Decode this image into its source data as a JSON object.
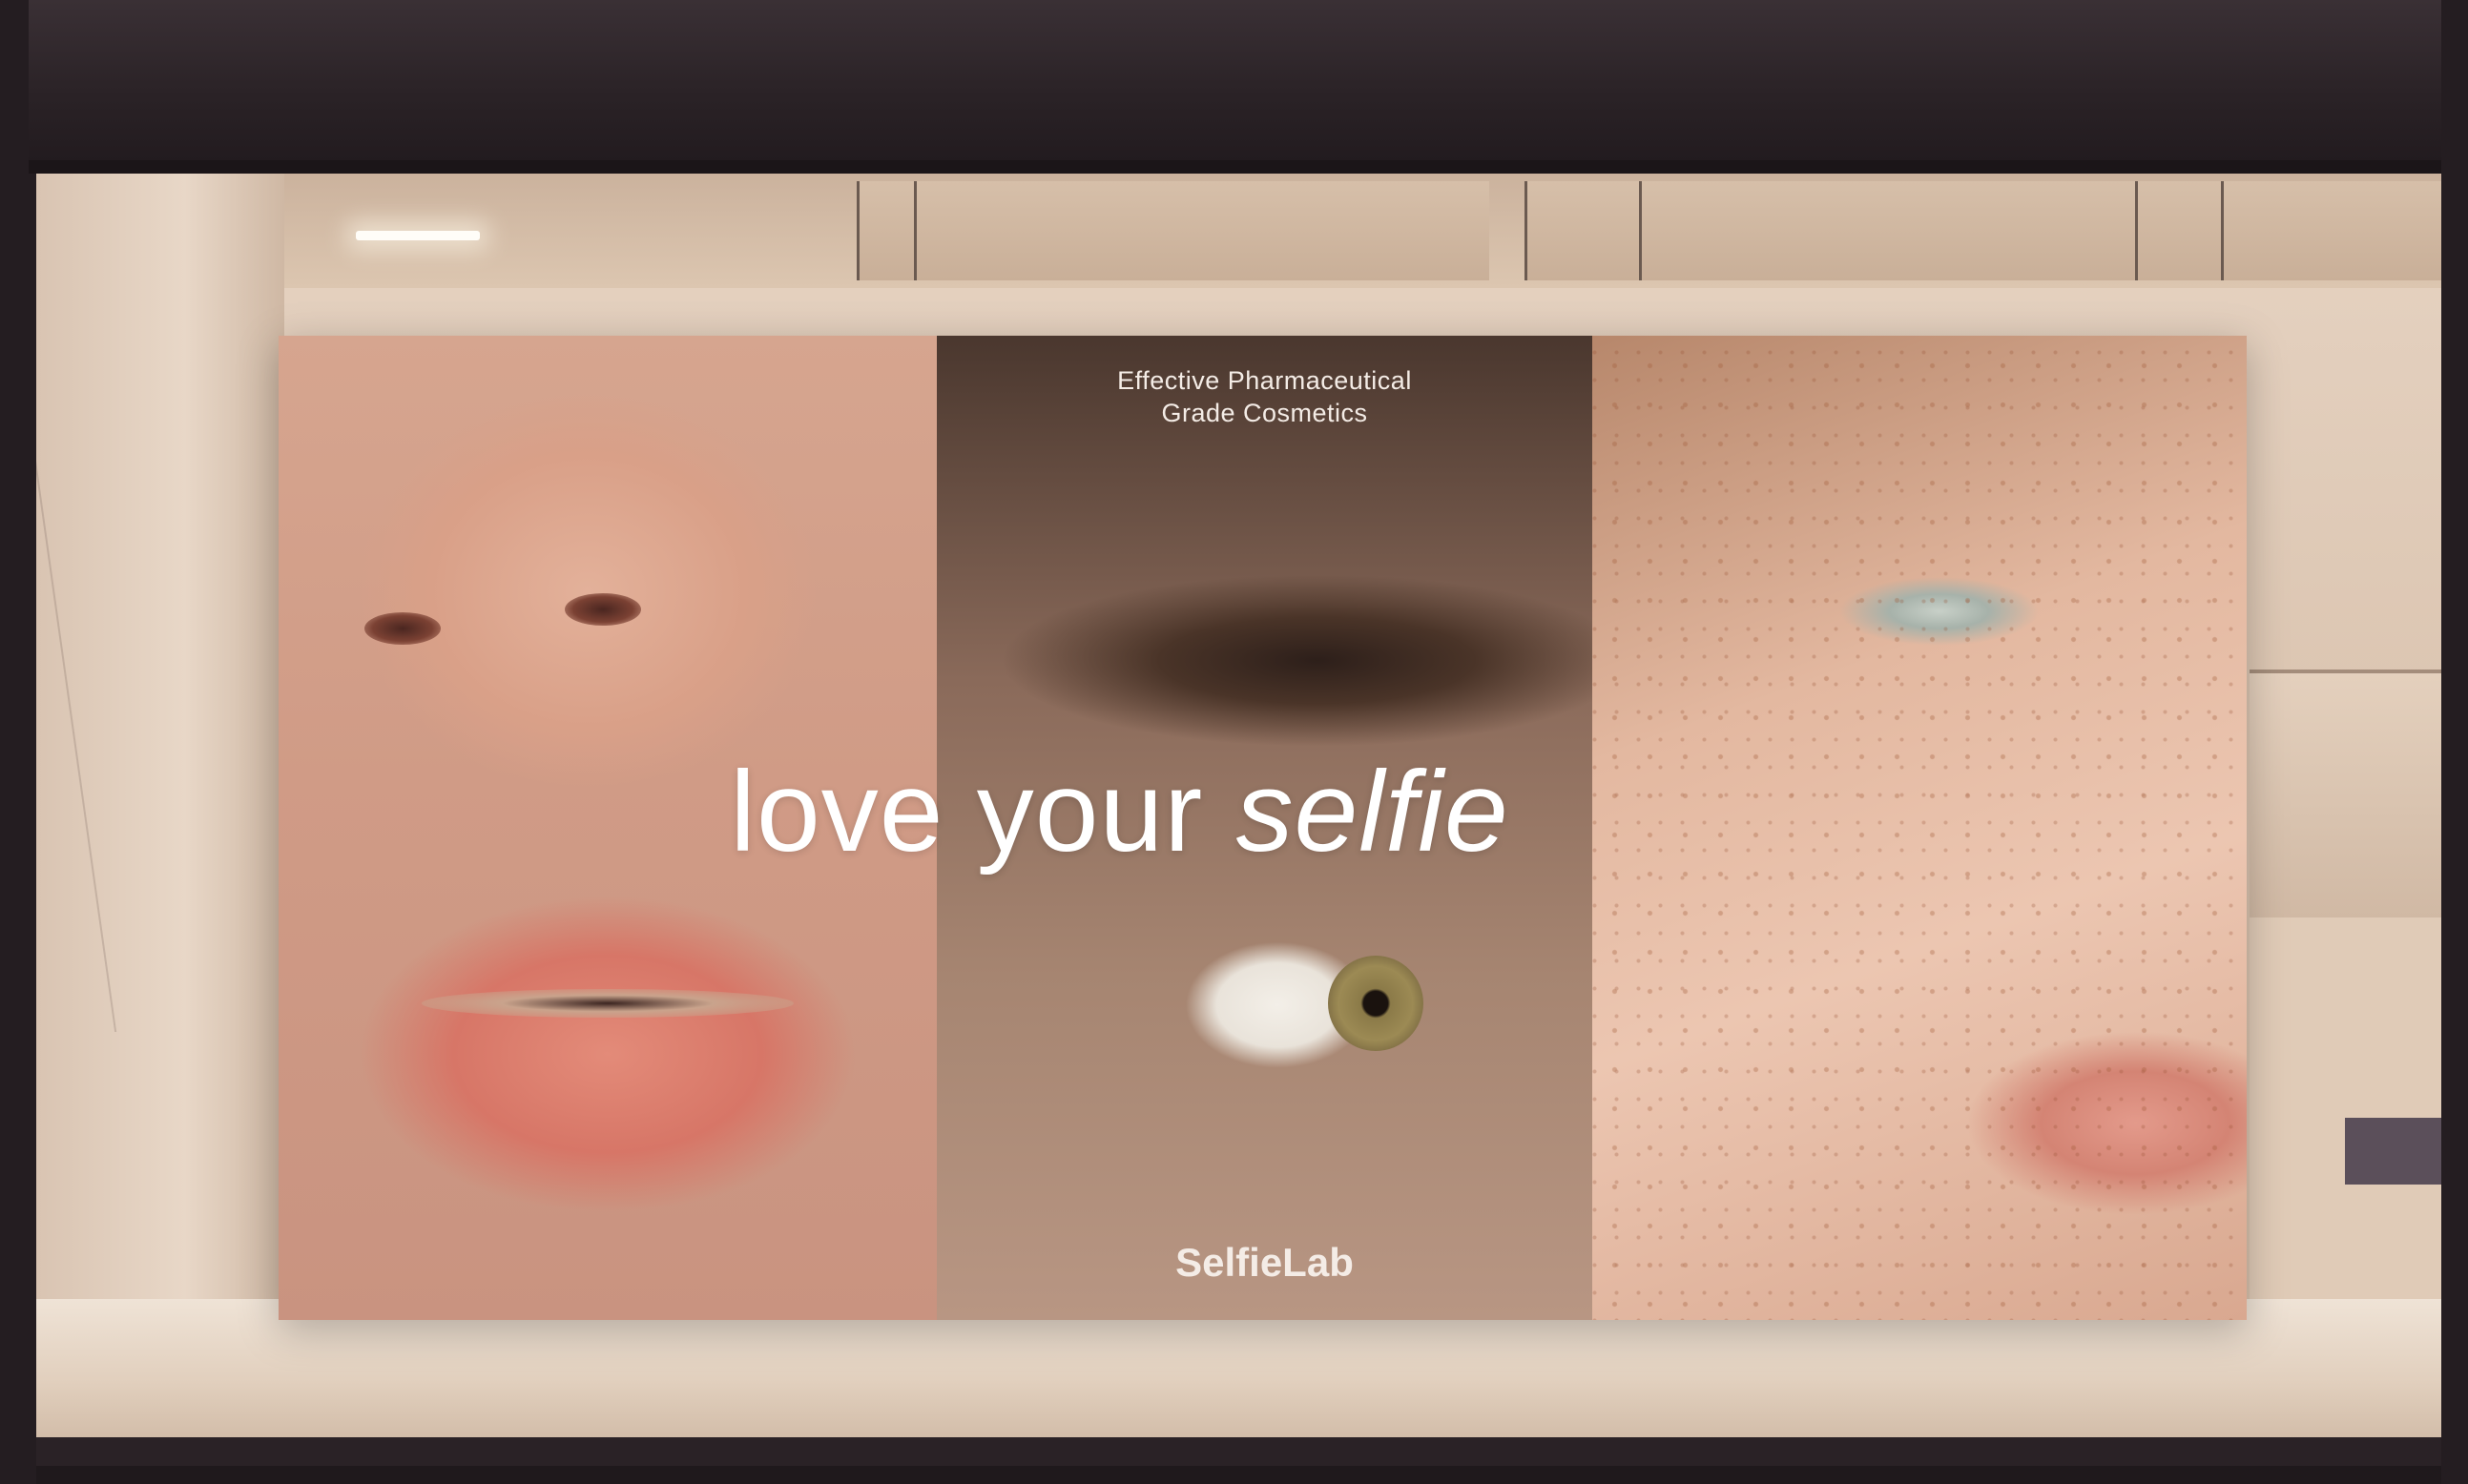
{
  "poster": {
    "tagline_line1": "Effective Pharmaceutical",
    "tagline_line2": "Grade Cosmetics",
    "headline_plain": "love your ",
    "headline_italic": "selfie",
    "brand": "SelfieLab"
  }
}
